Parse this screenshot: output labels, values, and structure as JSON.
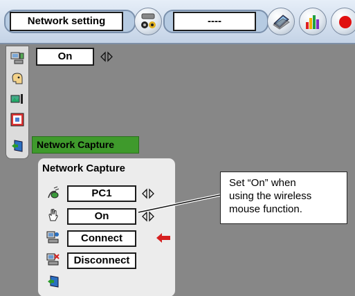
{
  "topbar": {
    "network_setting_label": "Network setting",
    "status_value": "----",
    "icons": [
      "video-input-icon",
      "laptop-icon",
      "bar-chart-icon",
      "red-record-icon"
    ]
  },
  "leftpanel": {
    "icons": [
      "network-pc-icon",
      "face-help-icon",
      "image-adjust-icon",
      "screen-window-icon",
      "network-capture-icon"
    ],
    "on_value": "On",
    "capture_tag": "Network Capture"
  },
  "submenu": {
    "title": "Network Capture",
    "rows": [
      {
        "icon": "wireless-mouse-icon",
        "value": "PC1",
        "has_arrows": true
      },
      {
        "icon": "hand-cursor-icon",
        "value": "On",
        "has_arrows": true
      },
      {
        "icon": "connect-icon",
        "value": "Connect",
        "has_arrows": false
      },
      {
        "icon": "disconnect-icon",
        "value": "Disconnect",
        "has_arrows": false
      },
      {
        "icon": "exit-door-icon"
      }
    ],
    "pointer": "red-arrow-icon"
  },
  "callout": {
    "lines": [
      "Set “On” when",
      "using the wireless",
      "mouse function."
    ]
  },
  "colors": {
    "background": "#878787",
    "topbar": "#c4d3e6",
    "capture_tag": "#3f9a2c",
    "pointer": "#d62020"
  }
}
